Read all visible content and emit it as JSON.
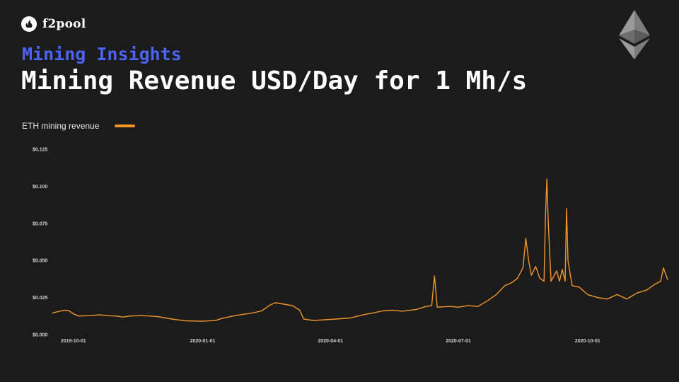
{
  "brand": {
    "name": "f2pool",
    "logo_icon": "f2pool-logo-icon"
  },
  "header": {
    "kicker": "Mining Insights",
    "title": "Mining Revenue USD/Day for 1 Mh/s",
    "kicker_color": "#4a63f2",
    "corner_icon": "ethereum-icon"
  },
  "chart_data": {
    "type": "line",
    "title": "Mining Revenue USD/Day for 1 Mh/s",
    "xlabel": "",
    "ylabel": "",
    "grid": false,
    "legend_position": "top-left",
    "x_range": [
      "2019-09-16",
      "2020-11-27"
    ],
    "ylim": [
      0,
      0.125
    ],
    "y_ticks": [
      {
        "value": 0.0,
        "label": "$0.000"
      },
      {
        "value": 0.025,
        "label": "$0.025"
      },
      {
        "value": 0.05,
        "label": "$0.050"
      },
      {
        "value": 0.075,
        "label": "$0.075"
      },
      {
        "value": 0.1,
        "label": "$0.100"
      },
      {
        "value": 0.125,
        "label": "$0.125"
      }
    ],
    "x_ticks": [
      {
        "value": "2019-10-01",
        "label": "2019-10-01"
      },
      {
        "value": "2020-01-01",
        "label": "2020-01-01"
      },
      {
        "value": "2020-04-01",
        "label": "2020-04-01"
      },
      {
        "value": "2020-07-01",
        "label": "2020-07-01"
      },
      {
        "value": "2020-10-01",
        "label": "2020-10-01"
      }
    ],
    "series": [
      {
        "name": "ETH mining revenue",
        "color": "#f0962a",
        "points": [
          [
            "2019-09-16",
            0.0145
          ],
          [
            "2019-09-20",
            0.0155
          ],
          [
            "2019-09-25",
            0.0165
          ],
          [
            "2019-09-28",
            0.016
          ],
          [
            "2019-10-01",
            0.014
          ],
          [
            "2019-10-05",
            0.0125
          ],
          [
            "2019-10-12",
            0.0128
          ],
          [
            "2019-10-20",
            0.0133
          ],
          [
            "2019-10-25",
            0.0128
          ],
          [
            "2019-11-01",
            0.0125
          ],
          [
            "2019-11-05",
            0.0118
          ],
          [
            "2019-11-10",
            0.0125
          ],
          [
            "2019-11-18",
            0.0128
          ],
          [
            "2019-11-25",
            0.0125
          ],
          [
            "2019-12-01",
            0.012
          ],
          [
            "2019-12-10",
            0.0105
          ],
          [
            "2019-12-20",
            0.0093
          ],
          [
            "2020-01-01",
            0.009
          ],
          [
            "2020-01-10",
            0.0095
          ],
          [
            "2020-01-15",
            0.011
          ],
          [
            "2020-01-25",
            0.013
          ],
          [
            "2020-02-05",
            0.0145
          ],
          [
            "2020-02-12",
            0.016
          ],
          [
            "2020-02-18",
            0.02
          ],
          [
            "2020-02-22",
            0.0215
          ],
          [
            "2020-02-28",
            0.0205
          ],
          [
            "2020-03-05",
            0.0195
          ],
          [
            "2020-03-10",
            0.0165
          ],
          [
            "2020-03-13",
            0.0105
          ],
          [
            "2020-03-20",
            0.0095
          ],
          [
            "2020-03-28",
            0.01
          ],
          [
            "2020-04-05",
            0.0105
          ],
          [
            "2020-04-15",
            0.0112
          ],
          [
            "2020-04-25",
            0.0135
          ],
          [
            "2020-05-01",
            0.0145
          ],
          [
            "2020-05-08",
            0.016
          ],
          [
            "2020-05-15",
            0.0165
          ],
          [
            "2020-05-22",
            0.0158
          ],
          [
            "2020-06-01",
            0.017
          ],
          [
            "2020-06-08",
            0.019
          ],
          [
            "2020-06-12",
            0.0195
          ],
          [
            "2020-06-14",
            0.0395
          ],
          [
            "2020-06-16",
            0.0185
          ],
          [
            "2020-06-25",
            0.019
          ],
          [
            "2020-07-01",
            0.0185
          ],
          [
            "2020-07-08",
            0.0195
          ],
          [
            "2020-07-15",
            0.019
          ],
          [
            "2020-07-22",
            0.023
          ],
          [
            "2020-07-28",
            0.027
          ],
          [
            "2020-08-03",
            0.033
          ],
          [
            "2020-08-08",
            0.035
          ],
          [
            "2020-08-12",
            0.038
          ],
          [
            "2020-08-16",
            0.045
          ],
          [
            "2020-08-18",
            0.065
          ],
          [
            "2020-08-20",
            0.05
          ],
          [
            "2020-08-22",
            0.04
          ],
          [
            "2020-08-25",
            0.046
          ],
          [
            "2020-08-28",
            0.038
          ],
          [
            "2020-08-31",
            0.036
          ],
          [
            "2020-09-01",
            0.08
          ],
          [
            "2020-09-02",
            0.105
          ],
          [
            "2020-09-03",
            0.075
          ],
          [
            "2020-09-05",
            0.036
          ],
          [
            "2020-09-09",
            0.043
          ],
          [
            "2020-09-11",
            0.036
          ],
          [
            "2020-09-13",
            0.044
          ],
          [
            "2020-09-15",
            0.036
          ],
          [
            "2020-09-16",
            0.085
          ],
          [
            "2020-09-17",
            0.05
          ],
          [
            "2020-09-20",
            0.033
          ],
          [
            "2020-09-25",
            0.032
          ],
          [
            "2020-10-01",
            0.027
          ],
          [
            "2020-10-08",
            0.025
          ],
          [
            "2020-10-15",
            0.024
          ],
          [
            "2020-10-22",
            0.027
          ],
          [
            "2020-10-29",
            0.024
          ],
          [
            "2020-11-05",
            0.028
          ],
          [
            "2020-11-12",
            0.03
          ],
          [
            "2020-11-18",
            0.034
          ],
          [
            "2020-11-22",
            0.036
          ],
          [
            "2020-11-24",
            0.045
          ],
          [
            "2020-11-27",
            0.037
          ]
        ]
      }
    ]
  }
}
